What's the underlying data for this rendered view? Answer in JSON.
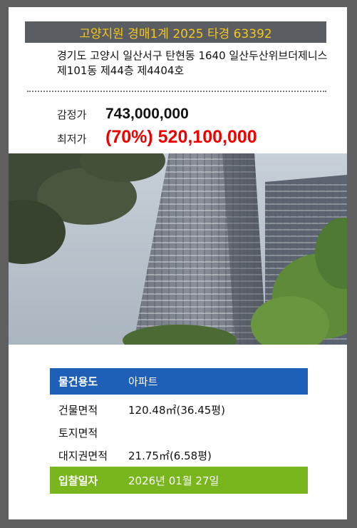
{
  "header": {
    "title": "고양지원 경매1계 2025 타경 63392"
  },
  "property": {
    "address": "경기도 고양시 일산서구 탄현동 1640 일산두산위브더제니스 제101동 제44층 제4404호"
  },
  "prices": {
    "appraisal_label": "감정가",
    "appraisal_value": "743,000,000",
    "minimum_label": "최저가",
    "minimum_value": "(70%) 520,100,000"
  },
  "details": {
    "use_label": "물건용도",
    "use_value": "아파트",
    "building_area_label": "건물면적",
    "building_area_value": "120.48㎡(36.45평)",
    "land_area_label": "토지면적",
    "land_area_value": "",
    "land_right_label": "대지권면적",
    "land_right_value": "21.75㎡(6.58평)",
    "bid_date_label": "입찰일자",
    "bid_date_value": "2026년 01월 27일"
  },
  "colors": {
    "background": "#5f5f5f",
    "title_bar": "#5a5d62",
    "title_text": "#f5c518",
    "minimum_price": "#ee0000",
    "use_row": "#1e5fb8",
    "date_row": "#79b51c"
  }
}
